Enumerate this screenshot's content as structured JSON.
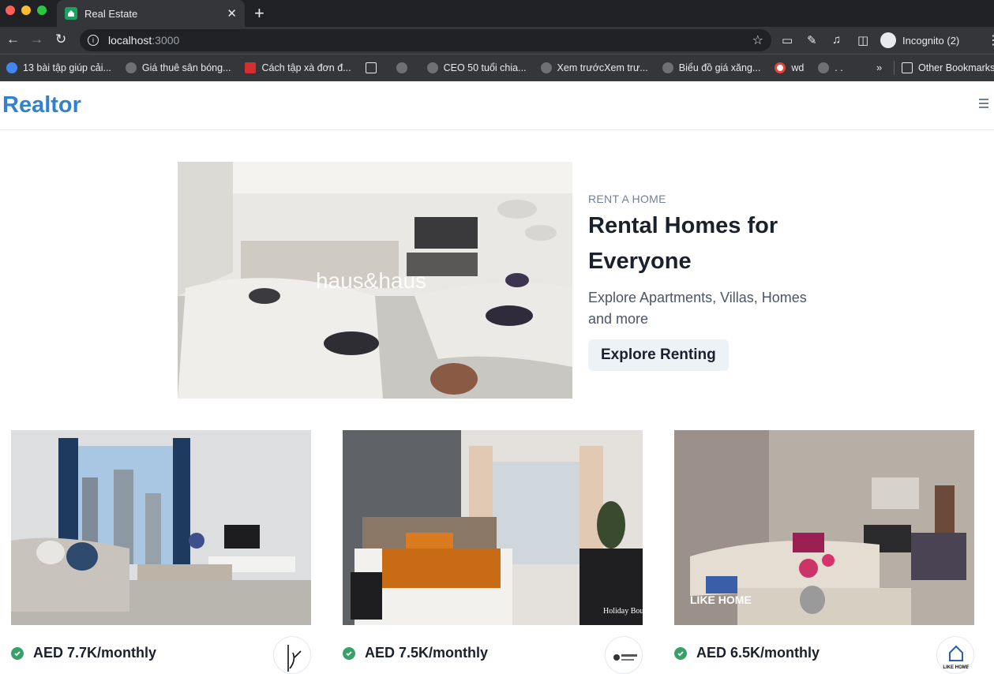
{
  "browser": {
    "tab_title": "Real Estate",
    "tab_close": "✕",
    "new_tab": "+",
    "url_host": "localhost",
    "url_port": ":3000",
    "profile_label": "Incognito (2)",
    "bookmarks": [
      "13 bài tập giúp cải...",
      "Giá thuê sân bóng...",
      "Cách tập xà đơn đ...",
      "",
      "",
      "CEO 50 tuổi chia...",
      "Xem trướcXem trư...",
      "Biểu đồ giá xăng...",
      "wd",
      ". ."
    ],
    "bookmarks_more": "»",
    "other_bookmarks": "Other Bookmarks"
  },
  "site": {
    "logo": "Realtor"
  },
  "hero": {
    "eyebrow": "RENT A HOME",
    "title": "Rental Homes for Everyone",
    "description": "Explore Apartments, Villas, Homes and more",
    "button": "Explore Renting",
    "image_watermark": "haus&haus"
  },
  "listings": [
    {
      "price": "AED 7.7K/monthly",
      "verified": true,
      "agency": "agency-logo-1"
    },
    {
      "price": "AED 7.5K/monthly",
      "verified": true,
      "agency": "Holiday Boulevard"
    },
    {
      "price": "AED 6.5K/monthly",
      "verified": true,
      "agency": "LIKE HOME"
    }
  ],
  "colors": {
    "brand": "#3182ce",
    "verified": "#38a169",
    "chrome_bg": "#202124"
  }
}
